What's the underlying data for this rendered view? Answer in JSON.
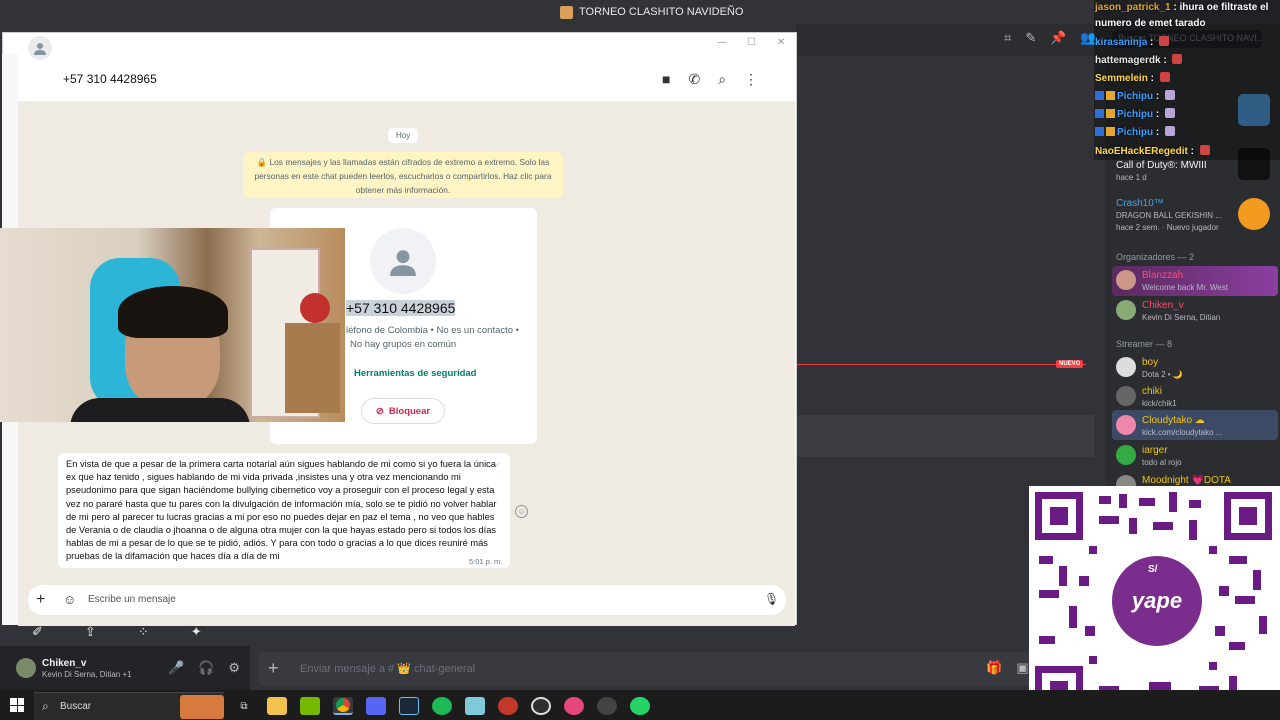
{
  "top_title": "TORNEO CLASHITO NAVIDEÑO",
  "discord": {
    "search_placeholder": "Buscar TORNEO CLASHITO NAVI...",
    "input_placeholder": "Enviar mensaje a # 👑 chat-general",
    "nuevo": "NUEVO",
    "user": {
      "name": "Chiken_v",
      "sub": "Kevin Di Serna, Ditian +1"
    },
    "members": [
      {
        "name": "Call of Duty®: MWIII",
        "sub": "hace 1 d"
      },
      {
        "name": "Crash10™",
        "sub": "DRAGON BALL GEKISHIN ..."
      },
      {
        "name": "hace 2 sem. · Nuevo jugador",
        "sub": ""
      }
    ],
    "org_section": "Organizadores — 2",
    "organizers": [
      {
        "name": "Blanzzah",
        "sub": "Welcome back Mr. West"
      },
      {
        "name": "Chiken_v",
        "sub": "Kevin Di Serna, Ditian"
      }
    ],
    "streamer_section": "Streamer — 8",
    "streamers": [
      {
        "name": "boy",
        "sub": "Dota 2 • 🌙"
      },
      {
        "name": "chiki",
        "sub": "kick/chik1"
      },
      {
        "name": "Cloudytako ☁",
        "sub": "kick.com/cloudytako ..."
      },
      {
        "name": "iarger",
        "sub": "todo al rojo"
      },
      {
        "name": "Moodnight 💗DOTA",
        "sub": ""
      }
    ]
  },
  "overlay_chat": [
    {
      "user": "jason_patrick_1",
      "text": "ihura oe filtraste el"
    },
    {
      "user": "",
      "text": "numero de emet tarado"
    },
    {
      "user": "kirasaninja",
      "text": ""
    },
    {
      "user": "hattemagerdk",
      "text": ""
    },
    {
      "user": "Semmelein",
      "text": ""
    },
    {
      "user": "Pichipu",
      "text": ""
    },
    {
      "user": "Pichipu",
      "text": ""
    },
    {
      "user": "Pichipu",
      "text": ""
    },
    {
      "user": "NaoEHackERegedit",
      "text": ""
    }
  ],
  "whatsapp": {
    "contact_number": "+57 310 4428965",
    "day_label": "Hoy",
    "encryption_notice": "🔒 Los mensajes y las llamadas están cifrados de extremo a extremo. Solo las personas en este chat pueden leerlos, escucharlos o compartirlos. Haz clic para obtener más información.",
    "card_number": "+57 310 4428965",
    "card_info_1": "léfono de Colombia • No es un contacto •",
    "card_info_2": "No hay grupos en común",
    "security_tools": "Herramientas de seguridad",
    "block_button": "Bloquear",
    "message_text": "En vista de que a pesar de la primera carta notarial aún  sigues hablando de mi como si yo fuera la única ex que haz tenido , sigues hablando de mi vida privada ,insistes una y otra vez mencionando mi pseudonimo para que sigan haciéndome bullying cibernetico voy a proseguir con el proceso legal y esta vez no pararé hasta que tu pares  con la divulgación de información mía,  solo se te pidió no volver hablar de mi pero al parecer tu lucras gracias a mi  por eso no puedes dejar en paz el tema  , no veo que hables de Verania o de claudia o jhoanna o de alguna otra mujer con la que hayas estado pero si todos los días hablas de mi a pesar de lo que se te pidió,  adiós. Y para con todo o gracias a lo que dices reuniré más pruebas de la difamación que haces día a día de mi",
    "message_time": "5:01 p. m.",
    "input_placeholder": "Escribe un mensaje"
  },
  "qr": {
    "brand": "yape",
    "symbol": "S/"
  },
  "taskbar": {
    "search": "Buscar"
  }
}
